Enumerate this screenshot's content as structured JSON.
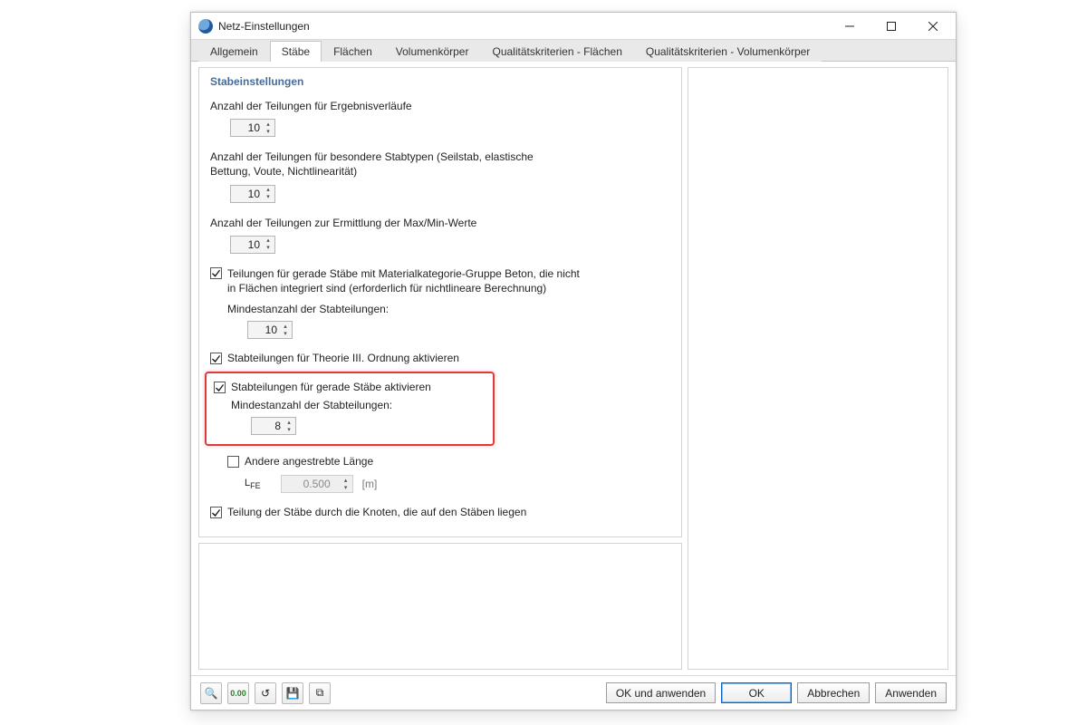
{
  "window": {
    "title": "Netz-Einstellungen"
  },
  "tabs": [
    {
      "label": "Allgemein"
    },
    {
      "label": "Stäbe"
    },
    {
      "label": "Flächen"
    },
    {
      "label": "Volumenkörper"
    },
    {
      "label": "Qualitätskriterien - Flächen"
    },
    {
      "label": "Qualitätskriterien - Volumenkörper"
    }
  ],
  "active_tab": 1,
  "panel": {
    "title": "Stabeinstellungen",
    "divisions_results_label": "Anzahl der Teilungen für Ergebnisverläufe",
    "divisions_results_value": "10",
    "divisions_special_label": "Anzahl der Teilungen für besondere Stabtypen (Seilstab, elastische Bettung, Voute, Nichtlinearität)",
    "divisions_special_value": "10",
    "divisions_maxmin_label": "Anzahl der Teilungen zur Ermittlung der Max/Min-Werte",
    "divisions_maxmin_value": "10",
    "concrete_checkbox_label": "Teilungen für gerade Stäbe mit Materialkategorie-Gruppe Beton, die nicht in Flächen integriert sind (erforderlich für nichtlineare Berechnung)",
    "concrete_min_label": "Mindestanzahl der Stabteilungen:",
    "concrete_min_value": "10",
    "theory3_checkbox_label": "Stabteilungen für Theorie III. Ordnung aktivieren",
    "straight_checkbox_label": "Stabteilungen für gerade Stäbe aktivieren",
    "straight_min_label": "Mindestanzahl der Stabteilungen:",
    "straight_min_value": "8",
    "other_len_checkbox_label": "Andere angestrebte Länge",
    "lfe_label": "LFE",
    "lfe_value": "0.500",
    "lfe_unit": "[m]",
    "nodes_checkbox_label": "Teilung der Stäbe durch die Knoten, die auf den Stäben liegen"
  },
  "footer": {
    "ok_apply": "OK und anwenden",
    "ok": "OK",
    "cancel": "Abbrechen",
    "apply": "Anwenden"
  }
}
